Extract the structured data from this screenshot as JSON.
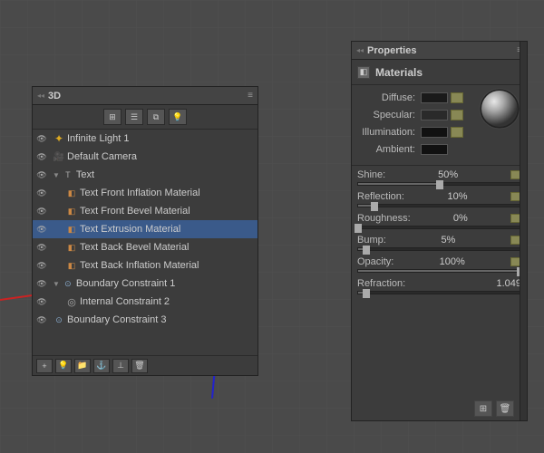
{
  "viewport": {
    "background": "#4a4a4a"
  },
  "panel3d": {
    "title": "3D",
    "collapse_icon": "▸▸",
    "close_icon": "✕",
    "menu_icon": "≡",
    "toolbar_buttons": [
      "grid-icon",
      "list-icon",
      "eye-icon",
      "light-icon"
    ],
    "layers": [
      {
        "id": 1,
        "indent": 0,
        "eye": true,
        "icon": "sun",
        "name": "Infinite Light 1",
        "selected": false
      },
      {
        "id": 2,
        "indent": 0,
        "eye": true,
        "icon": "camera",
        "name": "Default Camera",
        "selected": false
      },
      {
        "id": 3,
        "indent": 0,
        "eye": true,
        "icon": "text",
        "name": "Text",
        "selected": false,
        "expand": true
      },
      {
        "id": 4,
        "indent": 1,
        "eye": true,
        "icon": "mat",
        "name": "Text Front Inflation Material",
        "selected": false
      },
      {
        "id": 5,
        "indent": 1,
        "eye": true,
        "icon": "mat",
        "name": "Text Front Bevel Material",
        "selected": false
      },
      {
        "id": 6,
        "indent": 1,
        "eye": true,
        "icon": "mat",
        "name": "Text Extrusion Material",
        "selected": true
      },
      {
        "id": 7,
        "indent": 1,
        "eye": true,
        "icon": "mat",
        "name": "Text Back Bevel Material",
        "selected": false
      },
      {
        "id": 8,
        "indent": 1,
        "eye": true,
        "icon": "mat",
        "name": "Text Back Inflation Material",
        "selected": false
      },
      {
        "id": 9,
        "indent": 0,
        "eye": true,
        "icon": "constraint",
        "name": "Boundary Constraint 1",
        "selected": false,
        "expand": true
      },
      {
        "id": 10,
        "indent": 1,
        "eye": true,
        "icon": "radio",
        "name": "Internal Constraint 2",
        "selected": false
      },
      {
        "id": 11,
        "indent": 0,
        "eye": true,
        "icon": "constraint",
        "name": "Boundary Constraint 3",
        "selected": false
      }
    ],
    "bottom_buttons": [
      "add-icon",
      "light-icon",
      "folder-icon",
      "anchor-icon",
      "anchor2-icon",
      "delete-icon"
    ]
  },
  "panel_props": {
    "title": "Properties",
    "collapse_icon": "▸▸",
    "close_icon": "✕",
    "menu_icon": "≡",
    "tab": "Materials",
    "tab_icon": "mat-sphere",
    "materials": {
      "diffuse_label": "Diffuse:",
      "specular_label": "Specular:",
      "illumination_label": "Illumination:",
      "ambient_label": "Ambient:"
    },
    "sliders": [
      {
        "id": "shine",
        "label": "Shine:",
        "value": "50%",
        "fill_pct": 50,
        "thumb_pct": 50,
        "has_folder": true
      },
      {
        "id": "reflection",
        "label": "Reflection:",
        "value": "10%",
        "fill_pct": 10,
        "thumb_pct": 10,
        "has_folder": true
      },
      {
        "id": "roughness",
        "label": "Roughness:",
        "value": "0%",
        "fill_pct": 0,
        "thumb_pct": 0,
        "has_folder": true
      },
      {
        "id": "bump",
        "label": "Bump:",
        "value": "5%",
        "fill_pct": 5,
        "thumb_pct": 5,
        "has_folder": true
      },
      {
        "id": "opacity",
        "label": "Opacity:",
        "value": "100%",
        "fill_pct": 100,
        "thumb_pct": 100,
        "has_folder": true
      },
      {
        "id": "refraction",
        "label": "Refraction:",
        "value": "1.049",
        "fill_pct": 5,
        "thumb_pct": 5,
        "has_folder": false
      }
    ],
    "bottom_buttons": [
      "new-mat-icon",
      "delete-mat-icon"
    ]
  }
}
